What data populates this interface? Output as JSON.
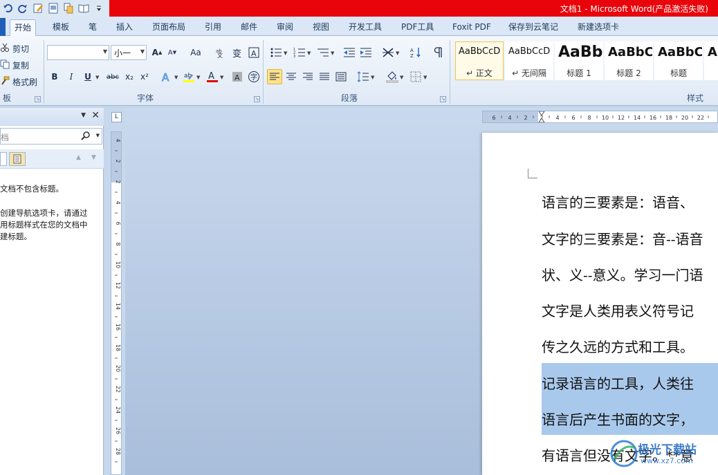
{
  "window": {
    "title": "文档1 - Microsoft Word(产品激活失败)"
  },
  "tabs": [
    {
      "label": "开始",
      "active": true
    },
    {
      "label": "模板"
    },
    {
      "label": "笔"
    },
    {
      "label": "插入"
    },
    {
      "label": "页面布局"
    },
    {
      "label": "引用"
    },
    {
      "label": "邮件"
    },
    {
      "label": "审阅"
    },
    {
      "label": "视图"
    },
    {
      "label": "开发工具"
    },
    {
      "label": "PDF工具"
    },
    {
      "label": "Foxit PDF"
    },
    {
      "label": "保存到云笔记"
    },
    {
      "label": "新建选项卡"
    }
  ],
  "ribbon": {
    "clipboard": {
      "cut": "剪切",
      "copy": "复制",
      "format_painter": "格式刷",
      "group_label": "板"
    },
    "font": {
      "font_name": "",
      "font_size": "小一",
      "group_label": "字体",
      "grow_label": "A",
      "shrink_label": "A",
      "case_label": "Aa",
      "bold": "B",
      "italic": "I",
      "underline": "U",
      "strike": "abc",
      "subscript": "x₂",
      "superscript": "x²"
    },
    "paragraph": {
      "group_label": "段落"
    },
    "styles": {
      "group_label": "样式",
      "items": [
        {
          "sample": "AaBbCcD",
          "name": "↵ 正文"
        },
        {
          "sample": "AaBbCcD",
          "name": "↵ 无间隔"
        },
        {
          "sample": "AaBb",
          "name": "标题 1"
        },
        {
          "sample": "AaBbC",
          "name": "标题 2"
        },
        {
          "sample": "AaBbC",
          "name": "标题"
        },
        {
          "sample": "A",
          "name": ""
        }
      ]
    }
  },
  "nav_pane": {
    "search_placeholder": "档",
    "message_line1": "文档不包含标题。",
    "message_line2": "创建导航选项卡，请通过",
    "message_line3": "用标题样式在您的文档中",
    "message_line4": "建标题。"
  },
  "hruler_labels": [
    "6",
    "4",
    "2",
    "2",
    "4",
    "6",
    "8",
    "10",
    "12",
    "14",
    "16",
    "18",
    "20",
    "22"
  ],
  "vruler_labels": [
    "4",
    "2",
    "2",
    "4",
    "6",
    "8",
    "10",
    "12",
    "14",
    "16",
    "18",
    "20",
    "22",
    "24",
    "26",
    "28"
  ],
  "document": {
    "lines": [
      "语言的三要素是：语音、",
      "文字的三要素是：音--语音",
      "状、义--意义。学习一门语",
      "文字是人类用表义符号记",
      "传之久远的方式和工具。",
      "记录语言的工具，人类往",
      "语言后产生书面的文字，",
      "有语言但没有文字。**意"
    ]
  },
  "watermark": {
    "text": "极光下载站",
    "url": "www.xz7.com"
  },
  "colors": {
    "title_red": "#e8040a",
    "highlight": "#a9c9ec",
    "selected_style": "#f0c34c"
  }
}
